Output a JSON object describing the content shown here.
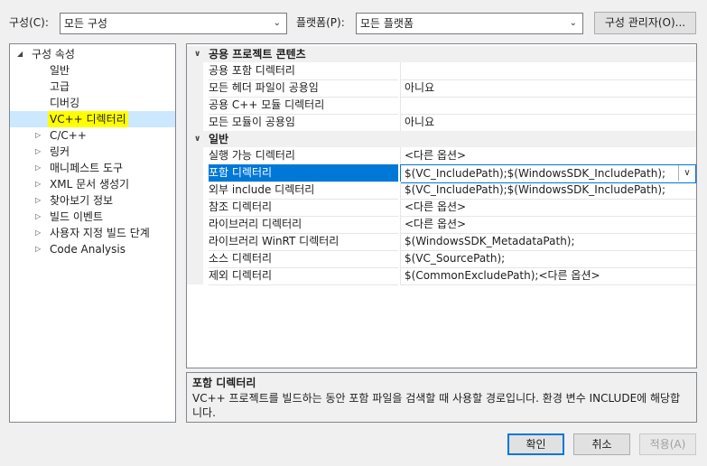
{
  "toolbar": {
    "config_label": "구성(C):",
    "config_value": "모든 구성",
    "platform_label": "플랫폼(P):",
    "platform_value": "모든 플랫폼",
    "config_manager_button": "구성 관리자(O)..."
  },
  "tree": {
    "root": "구성 속성",
    "items": [
      {
        "label": "일반",
        "expandable": false
      },
      {
        "label": "고급",
        "expandable": false
      },
      {
        "label": "디버깅",
        "expandable": false
      },
      {
        "label": "VC++ 디렉터리",
        "expandable": false,
        "selected": true
      },
      {
        "label": "C/C++",
        "expandable": true
      },
      {
        "label": "링커",
        "expandable": true
      },
      {
        "label": "매니페스트 도구",
        "expandable": true
      },
      {
        "label": "XML 문서 생성기",
        "expandable": true
      },
      {
        "label": "찾아보기 정보",
        "expandable": true
      },
      {
        "label": "빌드 이벤트",
        "expandable": true
      },
      {
        "label": "사용자 지정 빌드 단계",
        "expandable": true
      },
      {
        "label": "Code Analysis",
        "expandable": true
      }
    ]
  },
  "grid": {
    "categories": [
      {
        "title": "공용 프로젝트 콘텐츠",
        "rows": [
          {
            "name": "공용 포함 디렉터리",
            "value": ""
          },
          {
            "name": "모든 헤더 파일이 공용임",
            "value": "아니요"
          },
          {
            "name": "공용 C++ 모듈 디렉터리",
            "value": ""
          },
          {
            "name": "모든 모듈이 공용임",
            "value": "아니요"
          }
        ]
      },
      {
        "title": "일반",
        "rows": [
          {
            "name": "실행 가능 디렉터리",
            "value": "<다른 옵션>"
          },
          {
            "name": "포함 디렉터리",
            "value": "$(VC_IncludePath);$(WindowsSDK_IncludePath);",
            "selected": true
          },
          {
            "name": "외부 include 디렉터리",
            "value": "$(VC_IncludePath);$(WindowsSDK_IncludePath);"
          },
          {
            "name": "참조 디렉터리",
            "value": "<다른 옵션>"
          },
          {
            "name": "라이브러리 디렉터리",
            "value": "<다른 옵션>"
          },
          {
            "name": "라이브러리 WinRT 디렉터리",
            "value": "$(WindowsSDK_MetadataPath);"
          },
          {
            "name": "소스 디렉터리",
            "value": "$(VC_SourcePath);"
          },
          {
            "name": "제외 디렉터리",
            "value": "$(CommonExcludePath);<다른 옵션>"
          }
        ]
      }
    ]
  },
  "description": {
    "title": "포함 디렉터리",
    "text": "VC++ 프로젝트를 빌드하는 동안 포함 파일을 검색할 때 사용할 경로입니다.  환경 변수 INCLUDE에 해당합니다."
  },
  "buttons": {
    "ok": "확인",
    "cancel": "취소",
    "apply": "적용(A)"
  },
  "colors": {
    "selection": "#0078d7",
    "highlight": "#ffff00"
  }
}
